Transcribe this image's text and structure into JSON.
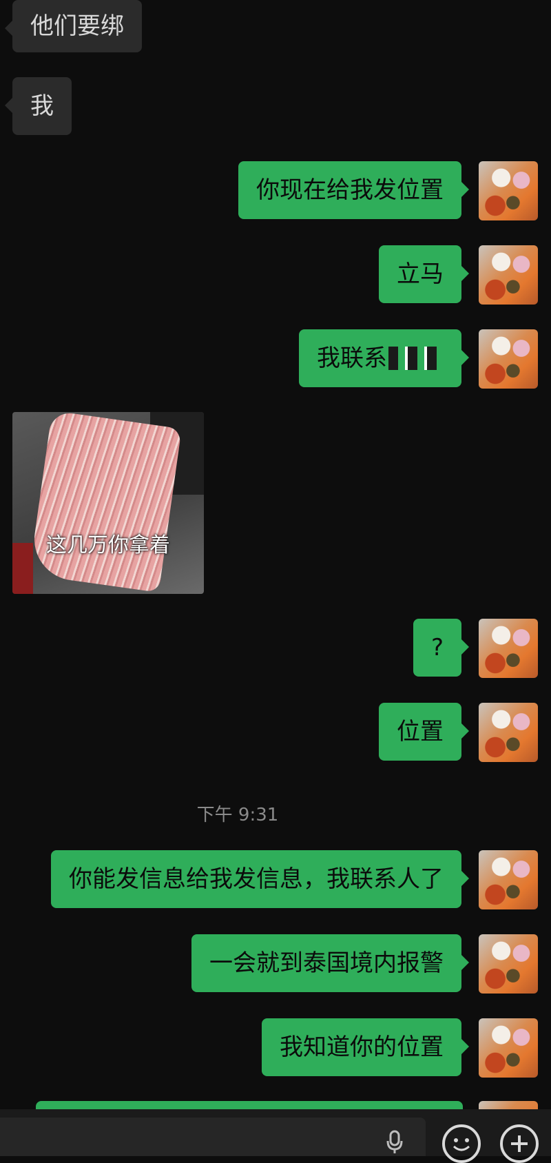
{
  "messages": [
    {
      "side": "in",
      "text": "他们要绑"
    },
    {
      "side": "in",
      "text": "我"
    },
    {
      "side": "out",
      "text": "你现在给我发位置"
    },
    {
      "side": "out",
      "text": "立马"
    },
    {
      "side": "out",
      "text": "我联系"
    },
    {
      "side": "in",
      "type": "image",
      "caption": "这几万你拿着"
    },
    {
      "side": "out",
      "text": "?"
    },
    {
      "side": "out",
      "text": "位置"
    },
    {
      "type": "timestamp",
      "text": "下午 9:31"
    },
    {
      "side": "out",
      "text": "你能发信息给我发信息，我联系人了"
    },
    {
      "side": "out",
      "text": "一会就到泰国境内报警"
    },
    {
      "side": "out",
      "text": "我知道你的位置"
    }
  ],
  "colors": {
    "outgoing_bubble": "#2fae5a",
    "incoming_bubble": "#2b2b2b",
    "background": "#0d0d0d"
  },
  "input_bar": {
    "icons": [
      "microphone-icon",
      "emoji-icon",
      "plus-icon"
    ]
  }
}
